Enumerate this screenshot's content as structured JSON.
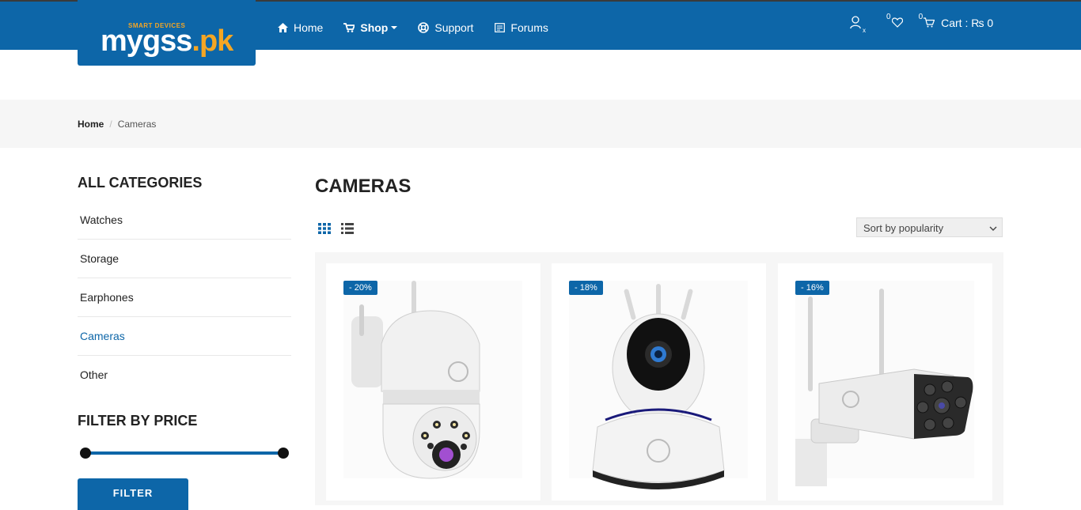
{
  "header": {
    "logo_small": "SMART DEVICES",
    "logo_main": "mygss",
    "logo_ext": ".pk",
    "nav": [
      {
        "label": "Home",
        "icon": "home-icon"
      },
      {
        "label": "Shop",
        "icon": "cart-icon"
      },
      {
        "label": "Support",
        "icon": "lifebuoy-icon"
      },
      {
        "label": "Forums",
        "icon": "forum-icon"
      }
    ],
    "wishlist_count": "0",
    "cart_count": "0",
    "cart_label": "Cart : ₨ 0"
  },
  "breadcrumb": {
    "home": "Home",
    "current": "Cameras"
  },
  "sidebar": {
    "categories_title": "ALL CATEGORIES",
    "categories": [
      "Watches",
      "Storage",
      "Earphones",
      "Cameras",
      "Other"
    ],
    "active_category": "Cameras",
    "filter_title": "FILTER BY PRICE",
    "filter_button": "FILTER"
  },
  "main": {
    "title": "CAMERAS",
    "sort_label": "Sort by popularity",
    "products": [
      {
        "badge": "- 20%"
      },
      {
        "badge": "- 18%"
      },
      {
        "badge": "- 16%"
      }
    ]
  },
  "colors": {
    "brand": "#0d66a8",
    "accent": "#f5a623"
  }
}
